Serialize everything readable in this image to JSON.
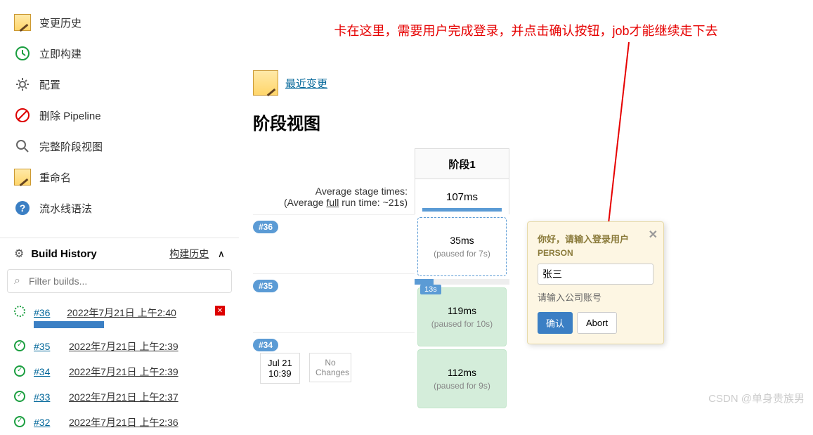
{
  "sidebar": {
    "items": [
      {
        "label": "变更历史",
        "icon": "notepad"
      },
      {
        "label": "立即构建",
        "icon": "clock"
      },
      {
        "label": "配置",
        "icon": "gear"
      },
      {
        "label": "删除 Pipeline",
        "icon": "forbidden"
      },
      {
        "label": "完整阶段视图",
        "icon": "magnifier"
      },
      {
        "label": "重命名",
        "icon": "notepad"
      },
      {
        "label": "流水线语法",
        "icon": "help"
      }
    ]
  },
  "history": {
    "title": "Build History",
    "link_label": "构建历史",
    "filter_placeholder": "Filter builds...",
    "builds": [
      {
        "num": "#36",
        "time": "2022年7月21日 上午2:40",
        "running": true
      },
      {
        "num": "#35",
        "time": "2022年7月21日 上午2:39",
        "running": false
      },
      {
        "num": "#34",
        "time": "2022年7月21日 上午2:39",
        "running": false
      },
      {
        "num": "#33",
        "time": "2022年7月21日 上午2:37",
        "running": false
      },
      {
        "num": "#32",
        "time": "2022年7月21日 上午2:36",
        "running": false
      }
    ]
  },
  "main": {
    "annotation": "卡在这里，需要用户完成登录，并点击确认按钮，job才能继续走下去",
    "recent_changes": "最近变更",
    "stage_title": "阶段视图",
    "avg_label": "Average stage times:",
    "avg_sub_prefix": "(Average ",
    "avg_sub_full": "full",
    "avg_sub_suffix": " run time: ~21s)",
    "stage_name": "阶段1",
    "avg_time": "107ms",
    "rows": [
      {
        "badge": "#36",
        "time": "35ms",
        "paused": "(paused for 7s)",
        "status": "running",
        "short_badge": "13s"
      },
      {
        "badge": "#35",
        "time": "119ms",
        "paused": "(paused for 10s)",
        "status": "done"
      },
      {
        "badge": "#34",
        "date": "Jul 21",
        "time_label": "10:39",
        "no_changes": "No Changes",
        "cell_time": "112ms",
        "paused": "(paused for 9s)",
        "status": "done"
      }
    ]
  },
  "popup": {
    "title": "你好，请输入登录用户",
    "field_label": "PERSON",
    "input_value": "张三",
    "hint": "请输入公司账号",
    "confirm": "确认",
    "abort": "Abort"
  },
  "watermark": "CSDN @单身贵族男"
}
